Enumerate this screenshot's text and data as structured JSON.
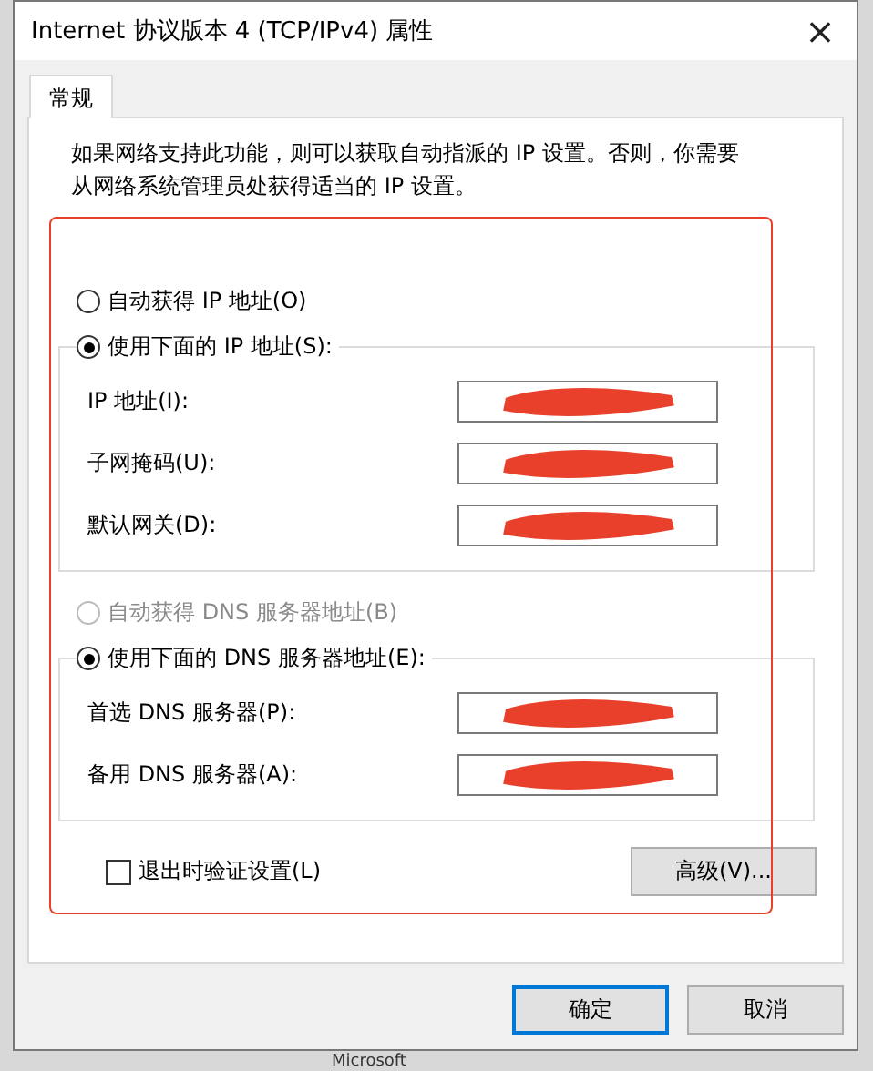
{
  "window": {
    "title": "Internet 协议版本 4 (TCP/IPv4) 属性",
    "close": "×"
  },
  "tabs": [
    {
      "label": "常规",
      "selected": true
    }
  ],
  "description": "如果网络支持此功能，则可以获取自动指派的 IP 设置。否则，你需要从网络系统管理员处获得适当的 IP 设置。",
  "ip_section": {
    "radios": [
      {
        "label": "自动获得 IP 地址(O)",
        "selected": false,
        "disabled": false
      },
      {
        "label": "使用下面的 IP 地址(S):",
        "selected": true,
        "disabled": false
      }
    ],
    "fields": [
      {
        "label": "IP 地址(I):",
        "redacted": true
      },
      {
        "label": "子网掩码(U):",
        "redacted": true
      },
      {
        "label": "默认网关(D):",
        "redacted": true
      }
    ]
  },
  "dns_section": {
    "radios": [
      {
        "label": "自动获得 DNS 服务器地址(B)",
        "selected": false,
        "disabled": true
      },
      {
        "label": "使用下面的 DNS 服务器地址(E):",
        "selected": true,
        "disabled": false
      }
    ],
    "fields": [
      {
        "label": "首选 DNS 服务器(P):",
        "redacted": true
      },
      {
        "label": "备用 DNS 服务器(A):",
        "redacted": true
      }
    ]
  },
  "validate_checkbox": {
    "label": "退出时验证设置(L)",
    "checked": false
  },
  "advanced_button": "高级(V)...",
  "annotation_frame": true,
  "buttons": [
    {
      "label": "确定",
      "default": true
    },
    {
      "label": "取消",
      "default": false
    }
  ],
  "background_text": "Microsoft"
}
